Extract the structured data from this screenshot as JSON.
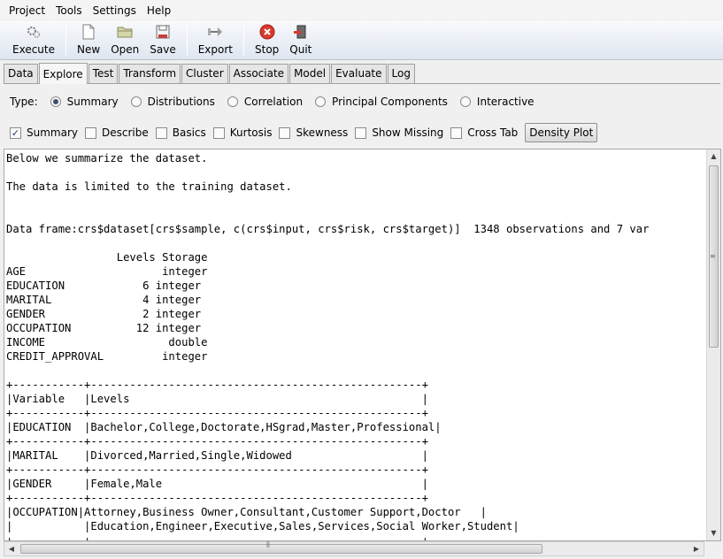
{
  "menubar": {
    "items": [
      {
        "label": "Project"
      },
      {
        "label": "Tools"
      },
      {
        "label": "Settings"
      },
      {
        "label": "Help"
      }
    ]
  },
  "toolbar": {
    "execute": "Execute",
    "new": "New",
    "open": "Open",
    "save": "Save",
    "export": "Export",
    "stop": "Stop",
    "quit": "Quit"
  },
  "tabs": [
    {
      "label": "Data"
    },
    {
      "label": "Explore"
    },
    {
      "label": "Test"
    },
    {
      "label": "Transform"
    },
    {
      "label": "Cluster"
    },
    {
      "label": "Associate"
    },
    {
      "label": "Model"
    },
    {
      "label": "Evaluate"
    },
    {
      "label": "Log"
    }
  ],
  "active_tab": "Explore",
  "type_row": {
    "label": "Type:",
    "options": [
      {
        "label": "Summary",
        "selected": true
      },
      {
        "label": "Distributions",
        "selected": false
      },
      {
        "label": "Correlation",
        "selected": false
      },
      {
        "label": "Principal Components",
        "selected": false
      },
      {
        "label": "Interactive",
        "selected": false
      }
    ]
  },
  "check_row": {
    "options": [
      {
        "label": "Summary",
        "checked": true
      },
      {
        "label": "Describe",
        "checked": false
      },
      {
        "label": "Basics",
        "checked": false
      },
      {
        "label": "Kurtosis",
        "checked": false
      },
      {
        "label": "Skewness",
        "checked": false
      },
      {
        "label": "Show Missing",
        "checked": false
      },
      {
        "label": "Cross Tab",
        "checked": false
      }
    ],
    "density_button": "Density Plot"
  },
  "output": {
    "lines": [
      "Below we summarize the dataset.",
      "",
      "The data is limited to the training dataset.",
      "",
      "",
      "Data frame:crs$dataset[crs$sample, c(crs$input, crs$risk, crs$target)]  1348 observations and 7 var",
      "",
      "                 Levels Storage",
      "AGE                     integer",
      "EDUCATION            6 integer",
      "MARITAL              4 integer",
      "GENDER               2 integer",
      "OCCUPATION          12 integer",
      "INCOME                   double",
      "CREDIT_APPROVAL         integer",
      "",
      "+-----------+---------------------------------------------------+",
      "|Variable   |Levels                                             |",
      "+-----------+---------------------------------------------------+",
      "|EDUCATION  |Bachelor,College,Doctorate,HSgrad,Master,Professional|",
      "+-----------+---------------------------------------------------+",
      "|MARITAL    |Divorced,Married,Single,Widowed                    |",
      "+-----------+---------------------------------------------------+",
      "|GENDER     |Female,Male                                        |",
      "+-----------+---------------------------------------------------+",
      "|OCCUPATION|Attorney,Business Owner,Consultant,Customer Support,Doctor   |",
      "|           |Education,Engineer,Executive,Sales,Services,Social Worker,Student|",
      "+-----------+---------------------------------------------------+"
    ]
  }
}
